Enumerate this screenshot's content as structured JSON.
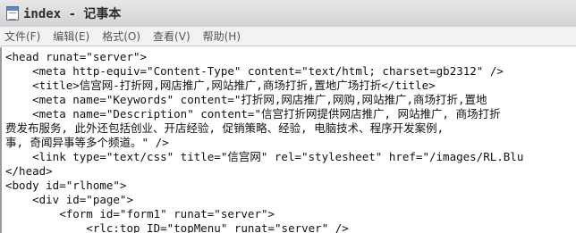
{
  "window": {
    "title": "index - 记事本"
  },
  "menu": [
    {
      "label": "文件(F)"
    },
    {
      "label": "编辑(E)"
    },
    {
      "label": "格式(O)"
    },
    {
      "label": "查看(V)"
    },
    {
      "label": "帮助(H)"
    }
  ],
  "editor": {
    "lines": [
      "<head runat=\"server\">",
      "    <meta http-equiv=\"Content-Type\" content=\"text/html; charset=gb2312\" />",
      "    <title>信宫网-打折网,网店推广,网站推广,商场打折,置地广场打折</title>",
      "    <meta name=\"Keywords\" content=\"打折网,网店推广,网购,网站推广,商场打折,置地",
      "    <meta name=\"Description\" content=\"信宫打折网提供网店推广, 网站推广, 商场打折",
      "费发布服务, 此外还包括创业、开店经验, 促销策略、经验, 电脑技术、程序开发案例,",
      "事, 奇闻异事等多个频道。\" />",
      "    <link type=\"text/css\" title=\"信宫网\" rel=\"stylesheet\" href=\"/images/RL.Blu",
      "</head>",
      "<body id=\"rlhome\">",
      "    <div id=\"page\">",
      "        <form id=\"form1\" runat=\"server\">",
      "            <rlc:top ID=\"topMenu\" runat=\"server\" />"
    ]
  }
}
